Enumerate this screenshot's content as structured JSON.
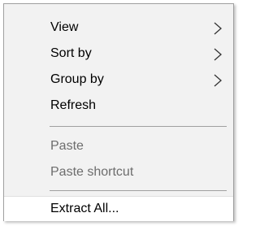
{
  "context_menu": {
    "items": [
      {
        "label": "View",
        "submenu_icon": "chevron-right-icon",
        "enabled": true
      },
      {
        "label": "Sort by",
        "submenu_icon": "chevron-right-icon",
        "enabled": true
      },
      {
        "label": "Group by",
        "submenu_icon": "chevron-right-icon",
        "enabled": true
      },
      {
        "label": "Refresh",
        "enabled": true
      },
      {
        "label": "Paste",
        "enabled": false
      },
      {
        "label": "Paste shortcut",
        "enabled": false
      },
      {
        "label": "Extract All...",
        "enabled": true
      }
    ]
  },
  "colors": {
    "menu_background": "#f2f2f2",
    "border": "#a0a0a0",
    "disabled_text": "#6d6d6d",
    "enabled_text": "#000000"
  }
}
